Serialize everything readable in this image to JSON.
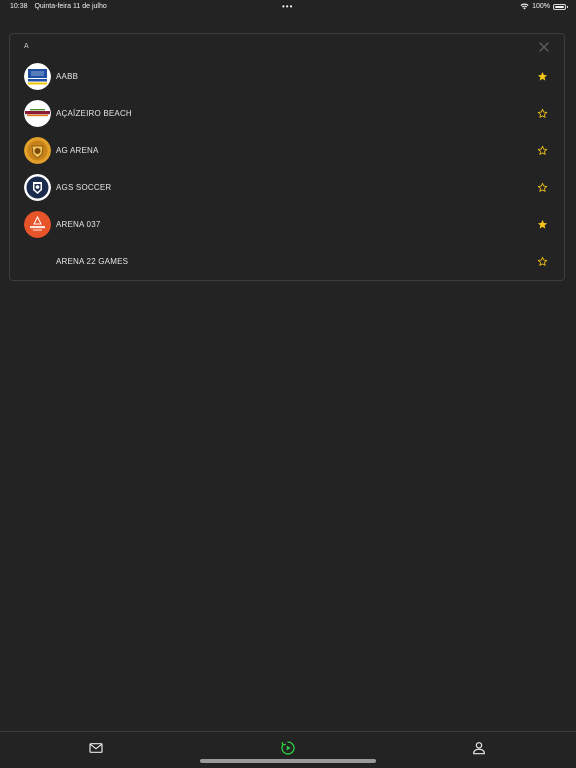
{
  "status_bar": {
    "time": "10:38",
    "date": "Quinta-feira 11 de julho",
    "dots": "•••",
    "battery": "100%"
  },
  "list": {
    "section_letter": "A",
    "items": [
      {
        "label": "AABB",
        "favorite": true
      },
      {
        "label": "AÇAÍZEIRO BEACH",
        "favorite": false
      },
      {
        "label": "AG ARENA",
        "favorite": false
      },
      {
        "label": "AGS SOCCER",
        "favorite": false
      },
      {
        "label": "ARENA 037",
        "favorite": true
      },
      {
        "label": "ARENA 22 GAMES",
        "favorite": false
      }
    ]
  },
  "icons": {
    "close": "close-icon",
    "favorite_on": "star-filled-icon",
    "favorite_off": "star-outline-icon",
    "tab_inbox": "envelope-icon",
    "tab_play": "play-circle-icon",
    "tab_profile": "person-icon"
  },
  "colors": {
    "background": "#232323",
    "star": "#f5c518",
    "accent_green": "#2ecc40"
  }
}
